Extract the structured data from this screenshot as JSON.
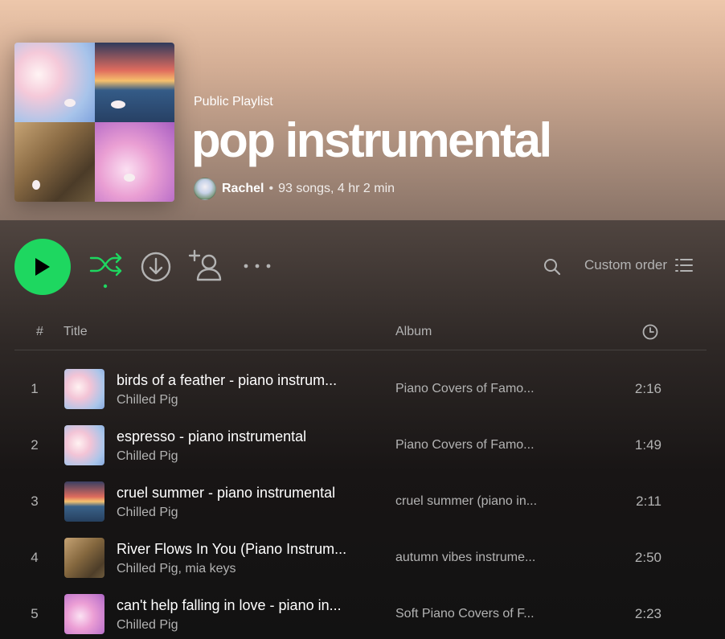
{
  "header": {
    "type_label": "Public Playlist",
    "title": "pop instrumental",
    "owner": "Rachel",
    "separator": "•",
    "stats": "93 songs, 4 hr 2 min"
  },
  "controls": {
    "sort_label": "Custom order"
  },
  "columns": {
    "number": "#",
    "title": "Title",
    "album": "Album"
  },
  "tracks": [
    {
      "num": "1",
      "title": "birds of a feather - piano instrum...",
      "artist": "Chilled Pig",
      "album": "Piano Covers of Famo...",
      "duration": "2:16",
      "art": "sky"
    },
    {
      "num": "2",
      "title": "espresso - piano instrumental",
      "artist": "Chilled Pig",
      "album": "Piano Covers of Famo...",
      "duration": "1:49",
      "art": "sky"
    },
    {
      "num": "3",
      "title": "cruel summer - piano instrumental",
      "artist": "Chilled Pig",
      "album": "cruel summer (piano in...",
      "duration": "2:11",
      "art": "sea"
    },
    {
      "num": "4",
      "title": "River Flows In You (Piano Instrum...",
      "artist": "Chilled Pig, mia keys",
      "album": "autumn vibes instrume...",
      "duration": "2:50",
      "art": "autumn"
    },
    {
      "num": "5",
      "title": "can't help falling in love - piano in...",
      "artist": "Chilled Pig",
      "album": "Soft Piano Covers of F...",
      "duration": "2:23",
      "art": "pink"
    }
  ],
  "colors": {
    "accent": "#1ed760",
    "header_top": "#edc7ab",
    "text_muted": "#b3b3b3",
    "background": "#121212"
  },
  "icons": [
    "play-icon",
    "shuffle-icon",
    "download-icon",
    "add-user-icon",
    "more-options-icon",
    "search-icon",
    "list-icon",
    "clock-icon"
  ]
}
